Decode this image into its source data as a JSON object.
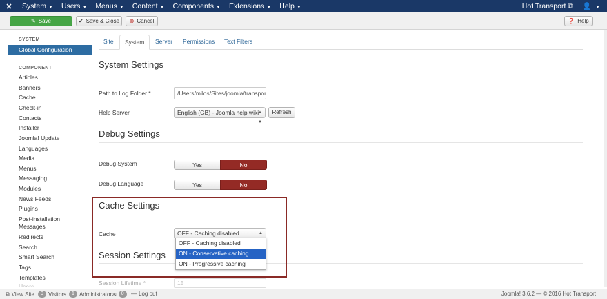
{
  "topnav": {
    "logo": "✕",
    "menus": [
      "System",
      "Users",
      "Menus",
      "Content",
      "Components",
      "Extensions",
      "Help"
    ],
    "site_link": "Hot Transport",
    "user_icon": "user-icon"
  },
  "toolbar": {
    "save_label": "Save",
    "save_close_label": "Save & Close",
    "cancel_label": "Cancel",
    "help_label": "Help"
  },
  "sidebar": {
    "system_heading": "SYSTEM",
    "active_item": "Global Configuration",
    "component_heading": "COMPONENT",
    "items": [
      "Articles",
      "Banners",
      "Cache",
      "Check-in",
      "Contacts",
      "Installer",
      "Joomla! Update",
      "Languages",
      "Media",
      "Menus",
      "Messaging",
      "Modules",
      "News Feeds",
      "Plugins",
      "Post-installation",
      "Messages",
      "Redirects",
      "Search",
      "Smart Search",
      "Tags",
      "Templates",
      "Users"
    ]
  },
  "tabs": [
    "Site",
    "System",
    "Server",
    "Permissions",
    "Text Filters"
  ],
  "active_tab": "System",
  "system_settings": {
    "title": "System Settings",
    "log_folder_label": "Path to Log Folder *",
    "log_folder_value": "/Users/milos/Sites/joomla/transport",
    "help_server_label": "Help Server",
    "help_server_value": "English (GB) - Joomla help wiki",
    "refresh_label": "Refresh"
  },
  "debug_settings": {
    "title": "Debug Settings",
    "debug_system_label": "Debug System",
    "debug_language_label": "Debug Language",
    "yes_label": "Yes",
    "no_label": "No"
  },
  "cache_settings": {
    "title": "Cache Settings",
    "cache_label": "Cache",
    "cache_value": "OFF - Caching disabled",
    "options": [
      "OFF - Caching disabled",
      "ON - Conservative caching",
      "ON - Progressive caching"
    ],
    "highlighted_option": "ON - Conservative caching"
  },
  "session_settings": {
    "title": "Session Settings",
    "lifetime_label": "Session Lifetime *",
    "lifetime_value": "15"
  },
  "statusbar": {
    "view_site": "View Site",
    "visitors_count": "0",
    "visitors_label": "Visitors",
    "admin_count": "1",
    "admin_label": "Administrator",
    "messages_count": "0",
    "logout_label": "Log out",
    "footer": "Joomla! 3.6.2  —  © 2016 Hot Transport"
  },
  "colors": {
    "nav_bg": "#1a3867",
    "save_green": "#46a546",
    "active_blue": "#2d6ca2",
    "no_red": "#942a25",
    "highlight_border": "#8a2a26",
    "dropdown_selected": "#2563c4"
  }
}
